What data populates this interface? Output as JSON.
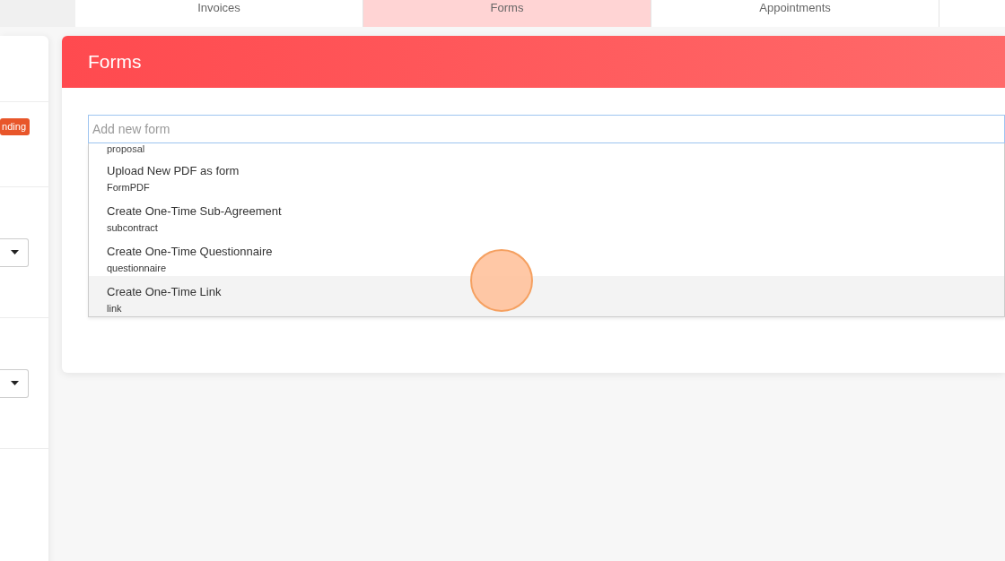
{
  "tabs": [
    {
      "label": "Invoices",
      "selected": false
    },
    {
      "label": "Forms",
      "selected": true
    },
    {
      "label": "Appointments",
      "selected": false
    }
  ],
  "sidebar": {
    "badge": "nding",
    "selects": [
      {
        "kind": "select"
      },
      {
        "kind": "select"
      }
    ]
  },
  "forms_panel": {
    "title": "Forms",
    "search": {
      "placeholder": "Add new form"
    },
    "dropdown": {
      "partial_subtitle": "proposal",
      "options": [
        {
          "label": "Upload New PDF as form",
          "subtitle": "FormPDF",
          "selected": false
        },
        {
          "label": "Create One-Time Sub-Agreement",
          "subtitle": "subcontract",
          "selected": false
        },
        {
          "label": "Create One-Time Questionnaire",
          "subtitle": "questionnaire",
          "selected": false
        },
        {
          "label": "Create One-Time Link",
          "subtitle": "link",
          "selected": true
        }
      ]
    }
  }
}
